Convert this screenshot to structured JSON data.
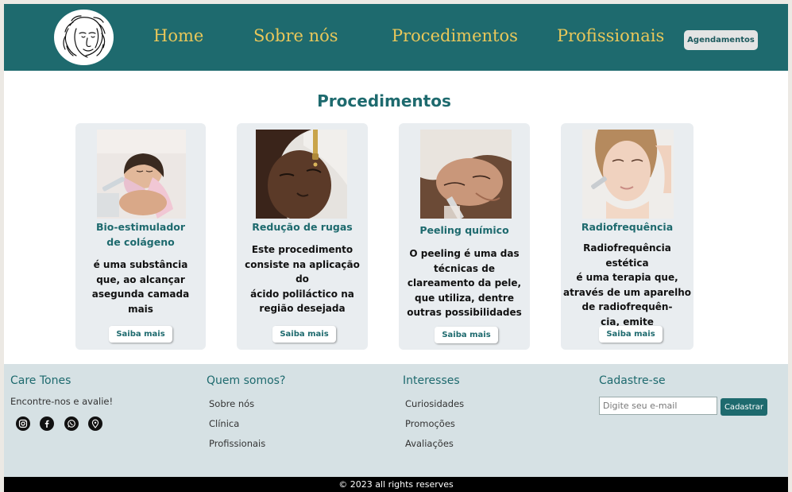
{
  "header": {
    "nav": [
      "Home",
      "Sobre nós",
      "Procedimentos",
      "Profissionais"
    ],
    "cta_label": "Agendamentos"
  },
  "main": {
    "title": "Procedimentos",
    "cards": [
      {
        "title_lines": [
          "Bio-estimulador",
          "de colágeno"
        ],
        "desc_lines": [
          "é uma substância",
          "que, ao alcançar",
          "asegunda camada",
          "mais"
        ],
        "button": "Saiba mais"
      },
      {
        "title_lines": [
          "Redução de rugas"
        ],
        "desc_lines": [
          "Este procedimento",
          "consiste na aplicação do",
          "ácido poliláctico na",
          "região desejada"
        ],
        "button": "Saiba mais"
      },
      {
        "title_lines": [
          "Peeling químico"
        ],
        "desc_lines": [
          "O peeling é uma das",
          "técnicas de",
          "clareamento da pele,",
          "que utiliza, dentre",
          "outras possibilidades"
        ],
        "button": "Saiba mais"
      },
      {
        "title_lines": [
          "Radiofrequência"
        ],
        "desc_lines": [
          "Radiofrequência estética",
          "é uma terapia que,",
          "através de um aparelho",
          "de radiofrequên-",
          "cia, emite"
        ],
        "button": "Saiba mais"
      }
    ]
  },
  "footer": {
    "brand": {
      "title": "Care Tones",
      "tagline": "Encontre-nos e avalie!",
      "social_icons": [
        "instagram-icon",
        "facebook-icon",
        "whatsapp-icon",
        "location-pin-icon"
      ]
    },
    "about": {
      "title": "Quem somos?",
      "links": [
        "Sobre nós",
        "Clínica",
        "Profissionais"
      ]
    },
    "interests": {
      "title": "Interesses",
      "links": [
        "Curiosidades",
        "Promoções",
        "Avaliações"
      ]
    },
    "signup": {
      "title": "Cadastre-se",
      "placeholder": "Digite seu e-mail",
      "value": "",
      "button": "Cadastrar"
    },
    "copyright": "© 2023 all rights reserves"
  },
  "colors": {
    "primary": "#1e6a6e",
    "nav_text": "#e8c75a",
    "card_bg": "#e9edf0",
    "footer_bg": "#d6e1e4"
  }
}
